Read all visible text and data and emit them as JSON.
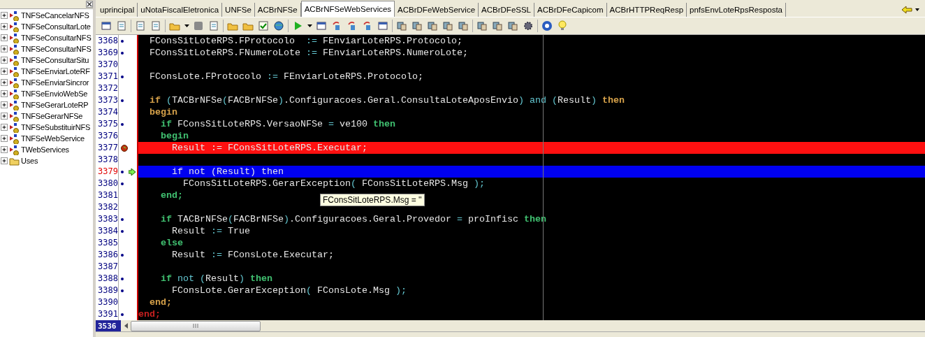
{
  "tree": {
    "items": [
      {
        "label": "TNFSeCancelarNFS",
        "kind": "class",
        "expanded": false
      },
      {
        "label": "TNFSeConsultarLote",
        "kind": "class",
        "expanded": false
      },
      {
        "label": "TNFSeConsultarNFS",
        "kind": "class",
        "expanded": false
      },
      {
        "label": "TNFSeConsultarNFS",
        "kind": "class",
        "expanded": false
      },
      {
        "label": "TNFSeConsultarSitu",
        "kind": "class",
        "expanded": false
      },
      {
        "label": "TNFSeEnviarLoteRF",
        "kind": "class",
        "expanded": false
      },
      {
        "label": "TNFSeEnviarSincror",
        "kind": "class",
        "expanded": false
      },
      {
        "label": "TNFSeEnvioWebSe",
        "kind": "class",
        "expanded": false
      },
      {
        "label": "TNFSeGerarLoteRP",
        "kind": "class",
        "expanded": false
      },
      {
        "label": "TNFSeGerarNFSe",
        "kind": "class",
        "expanded": false
      },
      {
        "label": "TNFSeSubstituirNFS",
        "kind": "class",
        "expanded": false
      },
      {
        "label": "TNFSeWebService",
        "kind": "class",
        "expanded": false
      },
      {
        "label": "TWebServices",
        "kind": "class",
        "expanded": false
      },
      {
        "label": "Uses",
        "kind": "folder",
        "expanded": false
      }
    ]
  },
  "tabs": [
    {
      "label": "uprincipal",
      "selected": false
    },
    {
      "label": "uNotaFiscalEletronica",
      "selected": false
    },
    {
      "label": "UNFSe",
      "selected": false
    },
    {
      "label": "ACBrNFSe",
      "selected": false
    },
    {
      "label": "ACBrNFSeWebServices",
      "selected": true
    },
    {
      "label": "ACBrDFeWebService",
      "selected": false
    },
    {
      "label": "ACBrDFeSSL",
      "selected": false
    },
    {
      "label": "ACBrDFeCapicom",
      "selected": false
    },
    {
      "label": "ACBrHTTPReqResp",
      "selected": false
    },
    {
      "label": "pnfsEnvLoteRpsResposta",
      "selected": false
    }
  ],
  "editor": {
    "lines": [
      {
        "number": "3368",
        "dot": true,
        "breakpoint": false,
        "current": false,
        "tokens": [
          {
            "kind": "text",
            "text": "  FConsSitLoteRPS.FProtocolo  "
          },
          {
            "kind": "operator",
            "text": ":="
          },
          {
            "kind": "text",
            "text": " FEnviarLoteRPS.Protocolo;"
          }
        ]
      },
      {
        "number": "3369",
        "dot": true,
        "breakpoint": false,
        "current": false,
        "tokens": [
          {
            "kind": "text",
            "text": "  FConsSitLoteRPS.FNumeroLote "
          },
          {
            "kind": "operator",
            "text": ":="
          },
          {
            "kind": "text",
            "text": " FEnviarLoteRPS.NumeroLote;"
          }
        ]
      },
      {
        "number": "3370",
        "dot": false,
        "breakpoint": false,
        "current": false
      },
      {
        "number": "3371",
        "dot": true,
        "breakpoint": false,
        "current": false,
        "tokens": [
          {
            "kind": "text",
            "text": "  FConsLote.FProtocolo "
          },
          {
            "kind": "operator",
            "text": ":="
          },
          {
            "kind": "text",
            "text": " FEnviarLoteRPS.Protocolo;"
          }
        ]
      },
      {
        "number": "3372",
        "dot": false,
        "breakpoint": false,
        "current": false
      },
      {
        "number": "3373",
        "dot": true,
        "breakpoint": false,
        "current": false,
        "tokens": [
          {
            "kind": "block",
            "text": "  if"
          },
          {
            "kind": "operator",
            "text": " ("
          },
          {
            "kind": "text",
            "text": "TACBrNFSe"
          },
          {
            "kind": "operator",
            "text": "("
          },
          {
            "kind": "text",
            "text": "FACBrNFSe"
          },
          {
            "kind": "operator",
            "text": ")"
          },
          {
            "kind": "text",
            "text": ".Configuracoes.Geral.ConsultaLoteAposEnvio"
          },
          {
            "kind": "operator",
            "text": ") and ("
          },
          {
            "kind": "text",
            "text": "Result"
          },
          {
            "kind": "operator",
            "text": ")"
          },
          {
            "kind": "block",
            "text": " then"
          }
        ]
      },
      {
        "number": "3374",
        "dot": false,
        "breakpoint": false,
        "current": false,
        "tokens": [
          {
            "kind": "block",
            "text": "  begin"
          }
        ]
      },
      {
        "number": "3375",
        "dot": true,
        "breakpoint": false,
        "current": false,
        "tokens": [
          {
            "kind": "keyword",
            "text": "    if"
          },
          {
            "kind": "text",
            "text": " FConsSitLoteRPS.VersaoNFSe "
          },
          {
            "kind": "operator",
            "text": "="
          },
          {
            "kind": "text",
            "text": " ve100 "
          },
          {
            "kind": "keyword",
            "text": "then"
          }
        ]
      },
      {
        "number": "3376",
        "dot": false,
        "breakpoint": false,
        "current": false,
        "tokens": [
          {
            "kind": "keyword",
            "text": "    begin"
          }
        ]
      },
      {
        "number": "3377",
        "breakpoint": true,
        "current": false,
        "tokens": [
          {
            "kind": "text",
            "text": "      Result := FConsSitLoteRPS.Executar;"
          }
        ]
      },
      {
        "number": "3378",
        "dot": false,
        "breakpoint": false,
        "current": false
      },
      {
        "number": "3379",
        "dot": true,
        "breakpoint": false,
        "current": true,
        "tokens": [
          {
            "kind": "text",
            "text": "      if not (Result) then"
          }
        ]
      },
      {
        "number": "3380",
        "dot": true,
        "breakpoint": false,
        "current": false,
        "tokens": [
          {
            "kind": "text",
            "text": "        FConsSitLoteRPS.GerarException"
          },
          {
            "kind": "operator",
            "text": "("
          },
          {
            "kind": "text",
            "text": " FConsSitLoteRPS.Msg "
          },
          {
            "kind": "operator",
            "text": ");"
          }
        ]
      },
      {
        "number": "3381",
        "dot": false,
        "breakpoint": false,
        "current": false,
        "tokens": [
          {
            "kind": "keyword",
            "text": "    end;"
          }
        ]
      },
      {
        "number": "3382",
        "dot": false,
        "breakpoint": false,
        "current": false
      },
      {
        "number": "3383",
        "dot": true,
        "breakpoint": false,
        "current": false,
        "tokens": [
          {
            "kind": "keyword",
            "text": "    if"
          },
          {
            "kind": "text",
            "text": " TACBrNFSe"
          },
          {
            "kind": "operator",
            "text": "("
          },
          {
            "kind": "text",
            "text": "FACBrNFSe"
          },
          {
            "kind": "operator",
            "text": ")"
          },
          {
            "kind": "text",
            "text": ".Configuracoes.Geral.Provedor "
          },
          {
            "kind": "operator",
            "text": "="
          },
          {
            "kind": "text",
            "text": " proInfisc "
          },
          {
            "kind": "keyword",
            "text": "then"
          }
        ]
      },
      {
        "number": "3384",
        "dot": true,
        "breakpoint": false,
        "current": false,
        "tokens": [
          {
            "kind": "text",
            "text": "      Result "
          },
          {
            "kind": "operator",
            "text": ":="
          },
          {
            "kind": "text",
            "text": " True"
          }
        ]
      },
      {
        "number": "3385",
        "dot": false,
        "breakpoint": false,
        "current": false,
        "tokens": [
          {
            "kind": "keyword",
            "text": "    else"
          }
        ]
      },
      {
        "number": "3386",
        "dot": true,
        "breakpoint": false,
        "current": false,
        "tokens": [
          {
            "kind": "text",
            "text": "      Result "
          },
          {
            "kind": "operator",
            "text": ":="
          },
          {
            "kind": "text",
            "text": " FConsLote.Executar;"
          }
        ]
      },
      {
        "number": "3387",
        "dot": false,
        "breakpoint": false,
        "current": false
      },
      {
        "number": "3388",
        "dot": true,
        "breakpoint": false,
        "current": false,
        "tokens": [
          {
            "kind": "keyword",
            "text": "    if"
          },
          {
            "kind": "operator",
            "text": " not ("
          },
          {
            "kind": "text",
            "text": "Result"
          },
          {
            "kind": "operator",
            "text": ")"
          },
          {
            "kind": "keyword",
            "text": " then"
          }
        ]
      },
      {
        "number": "3389",
        "dot": true,
        "breakpoint": false,
        "current": false,
        "tokens": [
          {
            "kind": "text",
            "text": "      FConsLote.GerarException"
          },
          {
            "kind": "operator",
            "text": "("
          },
          {
            "kind": "text",
            "text": " FConsLote.Msg "
          },
          {
            "kind": "operator",
            "text": ");"
          }
        ]
      },
      {
        "number": "3390",
        "dot": false,
        "breakpoint": false,
        "current": false,
        "tokens": [
          {
            "kind": "block",
            "text": "  end;"
          }
        ]
      },
      {
        "number": "3391",
        "dot": true,
        "breakpoint": false,
        "current": false,
        "tokens": [
          {
            "kind": "outer",
            "text": "end;"
          }
        ]
      }
    ],
    "tooltip": "FConsSitLoteRPS.Msg = ''",
    "line_count": "3536"
  }
}
